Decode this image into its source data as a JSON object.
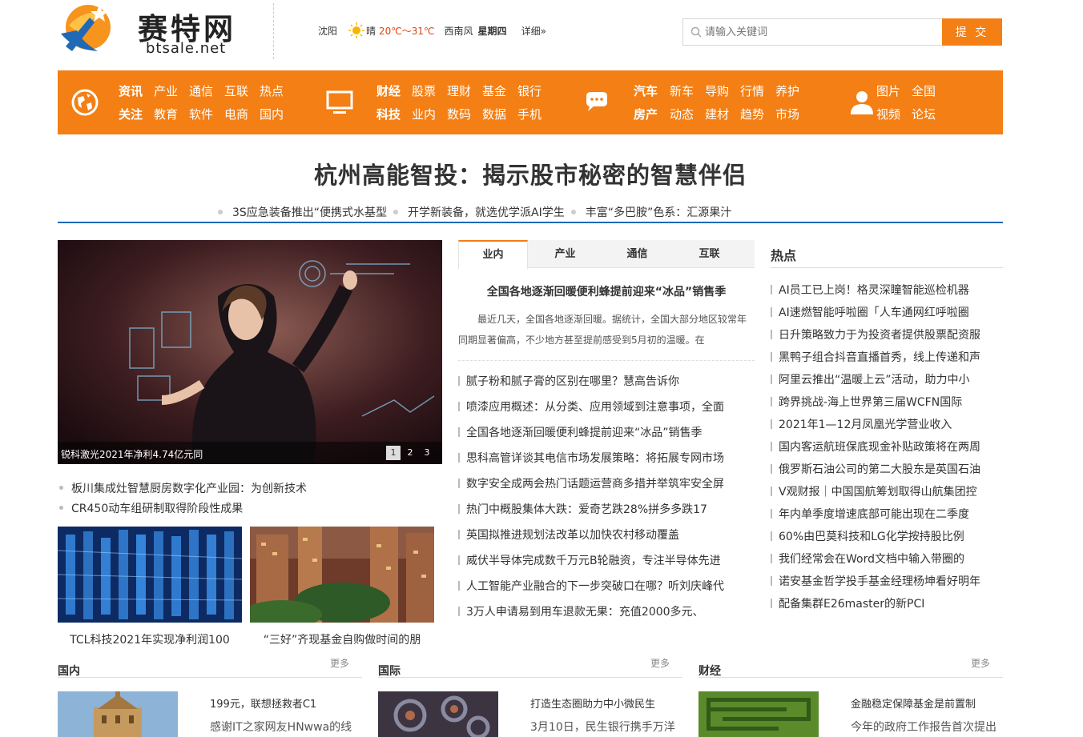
{
  "brand": {
    "logo_cn": "赛特网",
    "logo_en": "btsale.net"
  },
  "weather": {
    "city": "沈阳",
    "condition": "晴",
    "temp": "20℃～31℃",
    "wind": "西南风",
    "weekday": "星期四",
    "detail_link": "详细»"
  },
  "search": {
    "placeholder": "请输入关键词",
    "button": "提 交"
  },
  "nav": {
    "groups": [
      {
        "icon": "globe-icon",
        "row1": [
          "资讯",
          "产业",
          "通信",
          "互联",
          "热点"
        ],
        "row2": [
          "关注",
          "教育",
          "软件",
          "电商",
          "国内"
        ]
      },
      {
        "icon": "monitor-icon",
        "row1": [
          "财经",
          "股票",
          "理财",
          "基金",
          "银行"
        ],
        "row2": [
          "科技",
          "业内",
          "数码",
          "数据",
          "手机"
        ]
      },
      {
        "icon": "chat-icon",
        "row1": [
          "汽车",
          "新车",
          "导购",
          "行情",
          "养护"
        ],
        "row2": [
          "房产",
          "动态",
          "建材",
          "趋势",
          "市场"
        ]
      },
      {
        "icon": "user-icon",
        "row1": [
          "图片",
          "全国"
        ],
        "row2": [
          "视频",
          "论坛"
        ]
      }
    ]
  },
  "headline": {
    "title": "杭州高能智投：揭示股市秘密的智慧伴侣",
    "sublinks": [
      "3S应急装备推出“便携式水基型",
      "开学新装备，就选优学派AI学生",
      "丰富“多巴胺”色系：汇源果汁"
    ]
  },
  "slider": {
    "caption": "锐科激光2021年净利4.74亿元同",
    "pages": [
      "1",
      "2",
      "3"
    ],
    "active_page": 1
  },
  "left_list": [
    "板川集成灶智慧厨房数字化产业园：为创新技术",
    "CR450动车组研制取得阶段性成果"
  ],
  "thumbs": [
    {
      "caption": "TCL科技2021年实现净利润100"
    },
    {
      "caption": "“三好”齐现基金自购做时间的朋"
    }
  ],
  "tabs": {
    "items": [
      "业内",
      "产业",
      "通信",
      "互联"
    ],
    "active": 0
  },
  "feature": {
    "title": "全国各地逐渐回暖便利蜂提前迎来“冰品”销售季",
    "body": "最近几天，全国各地逐渐回暖。据统计，全国大部分地区较常年同期显著偏高，不少地方甚至提前感受到5月初的温暖。在"
  },
  "mid_list": [
    "腻子粉和腻子膏的区别在哪里？慧高告诉你",
    "喷漆应用概述：从分类、应用领域到注意事项，全面",
    "全国各地逐渐回暖便利蜂提前迎来“冰品”销售季",
    "思科高管详谈其电信市场发展策略：将拓展专网市场",
    "数字安全成两会热门话题运营商多措并举筑牢安全屏",
    "热门中概股集体大跌：爱奇艺跌28%拼多多跌17",
    "英国拟推进规划法改革以加快农村移动覆盖",
    "威伏半导体完成数千万元B轮融资，专注半导体先进",
    "人工智能产业融合的下一步突破口在哪？听刘庆峰代",
    "3万人申请易到用车退款无果：充值2000多元、"
  ],
  "hot": {
    "title": "热点",
    "items": [
      "AI员工已上岗！格灵深瞳智能巡检机器",
      "AI速燃智能呼啦圈「人车通网红呼啦圈",
      "日升策略致力于为投资者提供股票配资服",
      "黑鸭子组合抖音直播首秀，线上传递和声",
      "阿里云推出“温暖上云”活动，助力中小",
      "跨界挑战-海上世界第三届WCFN国际",
      "2021年1—12月凤凰光学营业收入",
      "国内客运航班保底现金补贴政策将在两周",
      "俄罗斯石油公司的第二大股东是英国石油",
      "V观财报｜中国国航筹划取得山航集团控",
      "年内单季度增速底部可能出现在二季度",
      "60%由巴莫科技和LG化学按持股比例",
      "我们经常会在Word文档中输入带圈的",
      "诺安基金哲学投手基金经理杨坤看好明年",
      "配备集群E26master的新PCI"
    ]
  },
  "sections": [
    {
      "title": "国内",
      "more": "更多",
      "headline": "199元，联想拯救者C1",
      "summary": "感谢IT之家网友HNwwa的线"
    },
    {
      "title": "国际",
      "more": "更多",
      "headline": "打造生态圈助力中小微民生",
      "summary": "3月10日，民生银行携手万洋"
    },
    {
      "title": "财经",
      "more": "更多",
      "headline": "金融稳定保障基金是前置制",
      "summary": "今年的政府工作报告首次提出"
    }
  ],
  "colors": {
    "accent": "#f47f14",
    "rule": "#1f69b7"
  }
}
